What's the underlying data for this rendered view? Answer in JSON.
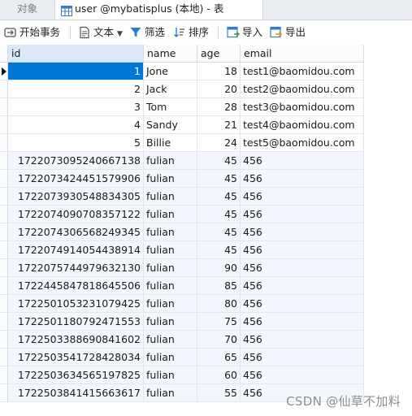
{
  "tabs": {
    "objects": "对象",
    "table_tab": "user @mybatisplus (本地) - 表"
  },
  "toolbar": {
    "begin_transaction": "开始事务",
    "text": "文本",
    "filter": "筛选",
    "sort": "排序",
    "import": "导入",
    "export": "导出"
  },
  "columns": [
    "id",
    "name",
    "age",
    "email"
  ],
  "rows": [
    {
      "id": "1",
      "name": "Jone",
      "age": "18",
      "email": "test1@baomidou.com"
    },
    {
      "id": "2",
      "name": "Jack",
      "age": "20",
      "email": "test2@baomidou.com"
    },
    {
      "id": "3",
      "name": "Tom",
      "age": "28",
      "email": "test3@baomidou.com"
    },
    {
      "id": "4",
      "name": "Sandy",
      "age": "21",
      "email": "test4@baomidou.com"
    },
    {
      "id": "5",
      "name": "Billie",
      "age": "24",
      "email": "test5@baomidou.com"
    },
    {
      "id": "1722073095240667138",
      "name": "fulian",
      "age": "45",
      "email": "456"
    },
    {
      "id": "1722073424451579906",
      "name": "fulian",
      "age": "45",
      "email": "456"
    },
    {
      "id": "1722073930548834305",
      "name": "fulian",
      "age": "45",
      "email": "456"
    },
    {
      "id": "1722074090708357122",
      "name": "fulian",
      "age": "45",
      "email": "456"
    },
    {
      "id": "1722074306568249345",
      "name": "fulian",
      "age": "45",
      "email": "456"
    },
    {
      "id": "1722074914054438914",
      "name": "fulian",
      "age": "45",
      "email": "456"
    },
    {
      "id": "1722075744979632130",
      "name": "fulian",
      "age": "90",
      "email": "456"
    },
    {
      "id": "1722445847818645506",
      "name": "fulian",
      "age": "85",
      "email": "456"
    },
    {
      "id": "1722501053231079425",
      "name": "fulian",
      "age": "80",
      "email": "456"
    },
    {
      "id": "1722501180792471553",
      "name": "fulian",
      "age": "75",
      "email": "456"
    },
    {
      "id": "1722503388690841602",
      "name": "fulian",
      "age": "70",
      "email": "456"
    },
    {
      "id": "1722503541728428034",
      "name": "fulian",
      "age": "65",
      "email": "456"
    },
    {
      "id": "1722503634565197825",
      "name": "fulian",
      "age": "60",
      "email": "456"
    },
    {
      "id": "1722503841415663617",
      "name": "fulian",
      "age": "55",
      "email": "456"
    }
  ],
  "selected_row": 0,
  "watermark": "CSDN @仙草不加料",
  "colors": {
    "selection": "#0078d7",
    "header_selected": "#dbe9f9",
    "alt_row": "#f3f7fd"
  }
}
